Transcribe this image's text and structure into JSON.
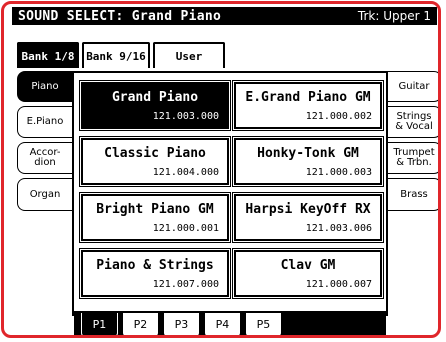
{
  "header": {
    "title": "SOUND SELECT: Grand Piano",
    "track": "Trk: Upper 1"
  },
  "bank_tabs": [
    {
      "label": "Bank 1/8",
      "active": true
    },
    {
      "label": "Bank 9/16",
      "active": false
    },
    {
      "label": "User",
      "active": false
    }
  ],
  "left_tabs": [
    {
      "label": "Piano",
      "active": true
    },
    {
      "label": "E.Piano",
      "active": false
    },
    {
      "label": "Accor-\ndion",
      "active": false
    },
    {
      "label": "Organ",
      "active": false
    }
  ],
  "right_tabs": [
    {
      "label": "Guitar"
    },
    {
      "label": "Strings\n& Vocal"
    },
    {
      "label": "Trumpet\n& Trbn."
    },
    {
      "label": "Brass"
    }
  ],
  "sounds": [
    {
      "name": "Grand Piano",
      "code": "121.003.000",
      "selected": true
    },
    {
      "name": "E.Grand Piano GM",
      "code": "121.000.002",
      "selected": false
    },
    {
      "name": "Classic Piano",
      "code": "121.004.000",
      "selected": false
    },
    {
      "name": "Honky-Tonk GM",
      "code": "121.000.003",
      "selected": false
    },
    {
      "name": "Bright Piano GM",
      "code": "121.000.001",
      "selected": false
    },
    {
      "name": "Harpsi KeyOff RX",
      "code": "121.003.006",
      "selected": false
    },
    {
      "name": "Piano & Strings",
      "code": "121.007.000",
      "selected": false
    },
    {
      "name": "Clav GM",
      "code": "121.000.007",
      "selected": false
    }
  ],
  "pages": [
    {
      "label": "P1",
      "active": true
    },
    {
      "label": "P2",
      "active": false
    },
    {
      "label": "P3",
      "active": false
    },
    {
      "label": "P4",
      "active": false
    },
    {
      "label": "P5",
      "active": false
    }
  ],
  "colors": {
    "frame": "#e0262b",
    "active": "#000000",
    "background": "#ffffff"
  }
}
